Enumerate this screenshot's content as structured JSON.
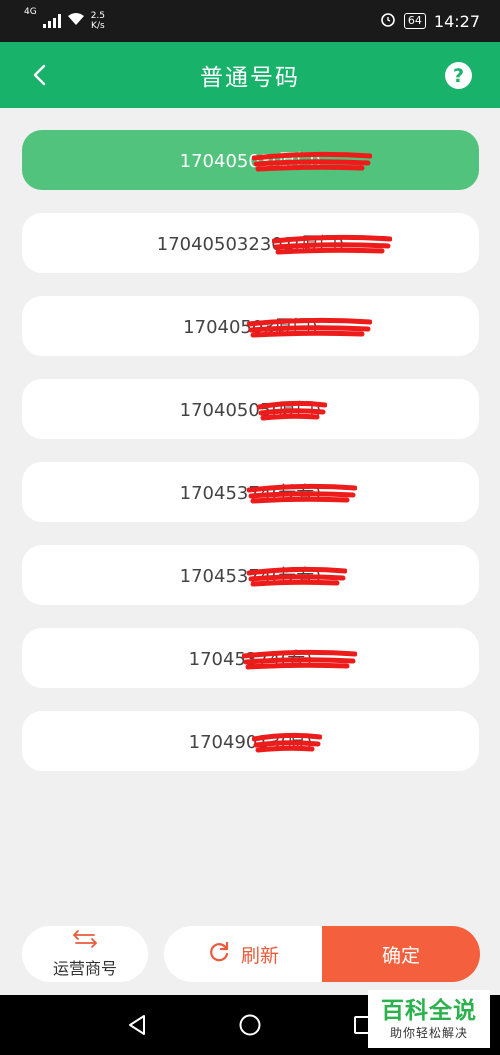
{
  "status_bar": {
    "network_type": "4G",
    "net_speed_value": "2.5",
    "net_speed_unit": "K/s",
    "battery": "64",
    "time": "14:27"
  },
  "header": {
    "title": "普通号码"
  },
  "numbers": [
    {
      "text": "17040503(厦门)",
      "selected": true
    },
    {
      "text": "170405032301(厦门)",
      "selected": false
    },
    {
      "text": "17040503厦门)",
      "selected": false
    },
    {
      "text": "17040505(厦门)",
      "selected": false
    },
    {
      "text": "17045374(长春)",
      "selected": false
    },
    {
      "text": "17045374(长春)",
      "selected": false
    },
    {
      "text": "17045374(春)",
      "selected": false
    },
    {
      "text": "17049013(原)",
      "selected": false
    }
  ],
  "bottom": {
    "carrier_label": "运营商号",
    "refresh_label": "刷新",
    "confirm_label": "确定"
  },
  "watermark": {
    "title": "百科全说",
    "subtitle": "助你轻松解决"
  },
  "colors": {
    "header": "#18b26a",
    "selected": "#52c37c",
    "accent": "#f4603d",
    "redaction": "#ee1b1b"
  }
}
